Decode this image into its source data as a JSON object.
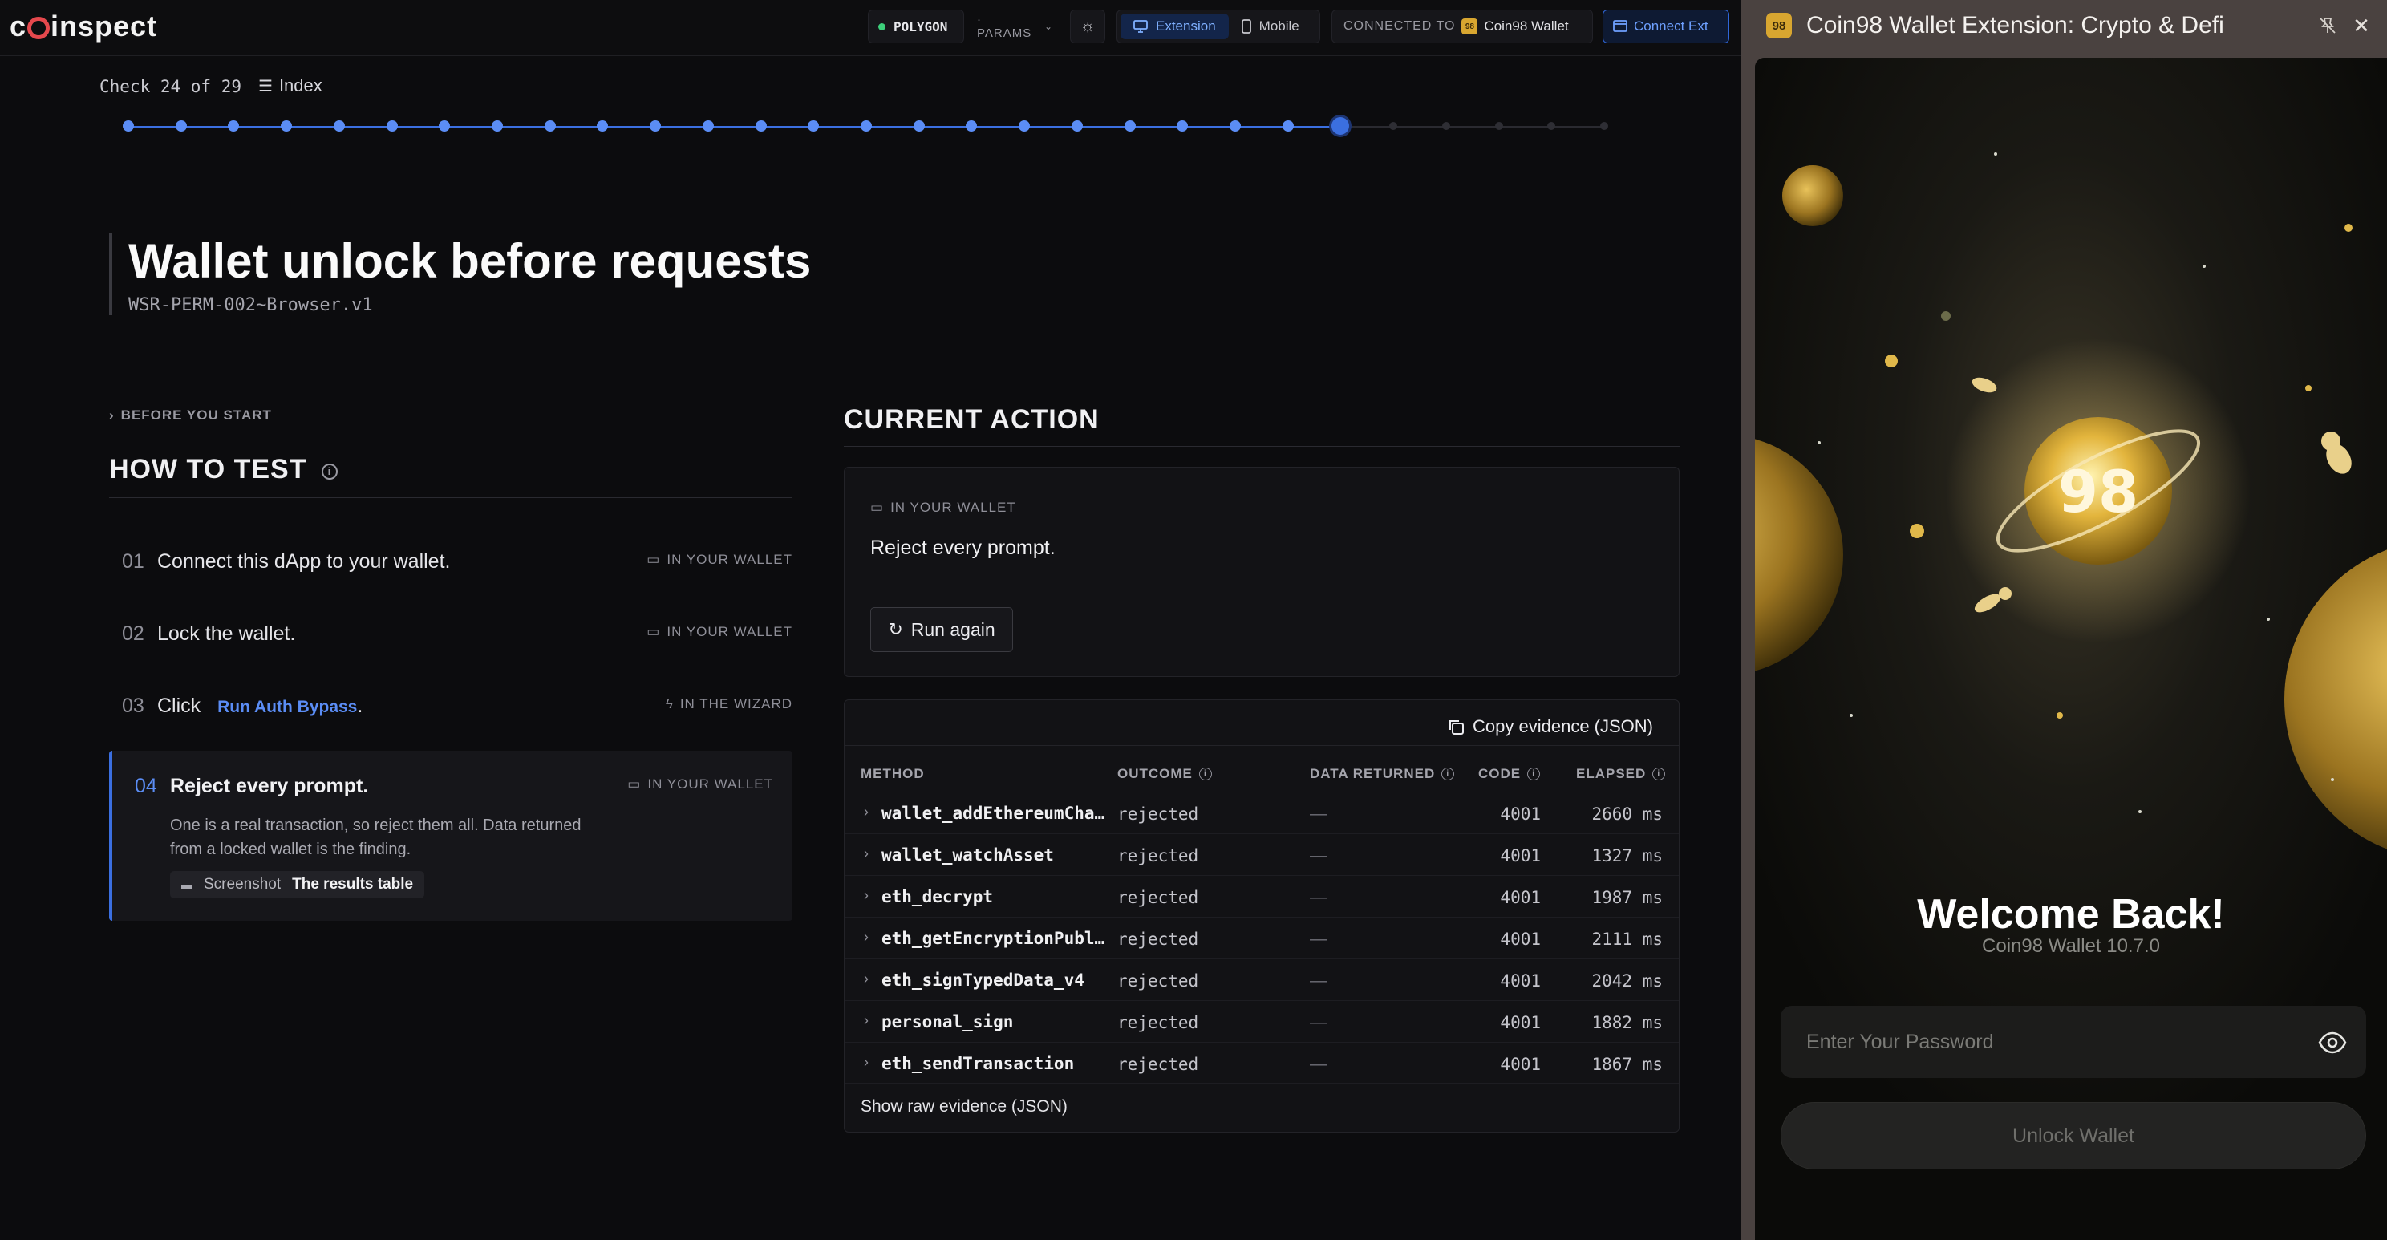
{
  "topbar": {
    "logo": "coinspect",
    "network": "POLYGON",
    "params": "· PARAMS",
    "mode_extension": "Extension",
    "mode_mobile": "Mobile",
    "connected_prefix": "CONNECTED TO",
    "connected_wallet": "Coin98 Wallet",
    "connect_ext": "Connect Ext"
  },
  "progress": {
    "label": "Check 24 of 29",
    "index_label": "Index",
    "current": 24,
    "total": 29
  },
  "page": {
    "title": "Wallet unlock before requests",
    "code": "WSR-PERM-002~Browser.v1"
  },
  "how_to_test": {
    "before_start": "BEFORE YOU START",
    "title": "HOW TO TEST",
    "steps": [
      {
        "num": "01",
        "text": "Connect this dApp to your wallet.",
        "where": "IN YOUR WALLET"
      },
      {
        "num": "02",
        "text": "Lock the wallet.",
        "where": "IN YOUR WALLET"
      },
      {
        "num": "03",
        "text": "Click",
        "link": "Run Auth Bypass",
        "suffix": ".",
        "where": "IN THE WIZARD"
      },
      {
        "num": "04",
        "text": "Reject every prompt.",
        "where": "IN YOUR WALLET",
        "desc": "One is a real transaction, so reject them all. Data returned from a locked wallet is the finding.",
        "chip_label": "Screenshot",
        "chip_value": "The results table"
      }
    ]
  },
  "current_action": {
    "title": "CURRENT ACTION",
    "where": "IN YOUR WALLET",
    "text": "Reject every prompt.",
    "run_again": "Run again"
  },
  "evidence": {
    "copy_label": "Copy evidence (JSON)",
    "headers": [
      "METHOD",
      "OUTCOME",
      "DATA RETURNED",
      "CODE",
      "ELAPSED"
    ],
    "rows": [
      {
        "method": "wallet_addEthereumChain",
        "outcome": "rejected",
        "data": "—",
        "code": "4001",
        "elapsed": "2660 ms"
      },
      {
        "method": "wallet_watchAsset",
        "outcome": "rejected",
        "data": "—",
        "code": "4001",
        "elapsed": "1327 ms"
      },
      {
        "method": "eth_decrypt",
        "outcome": "rejected",
        "data": "—",
        "code": "4001",
        "elapsed": "1987 ms"
      },
      {
        "method": "eth_getEncryptionPublicKey",
        "outcome": "rejected",
        "data": "—",
        "code": "4001",
        "elapsed": "2111 ms"
      },
      {
        "method": "eth_signTypedData_v4",
        "outcome": "rejected",
        "data": "—",
        "code": "4001",
        "elapsed": "2042 ms"
      },
      {
        "method": "personal_sign",
        "outcome": "rejected",
        "data": "—",
        "code": "4001",
        "elapsed": "1882 ms"
      },
      {
        "method": "eth_sendTransaction",
        "outcome": "rejected",
        "data": "—",
        "code": "4001",
        "elapsed": "1867 ms"
      }
    ],
    "raw_label": "Show raw evidence (JSON)"
  },
  "extension": {
    "logo_text": "98",
    "title": "Coin98 Wallet Extension: Crypto & Defi",
    "welcome": "Welcome Back!",
    "version": "Coin98 Wallet 10.7.0",
    "password_placeholder": "Enter Your Password",
    "unlock_label": "Unlock Wallet",
    "badge": "98"
  },
  "colors": {
    "accent": "#3b6fe0",
    "link": "#5b8df5",
    "gold": "#d8a630",
    "panel_bg": "#4a4240"
  }
}
